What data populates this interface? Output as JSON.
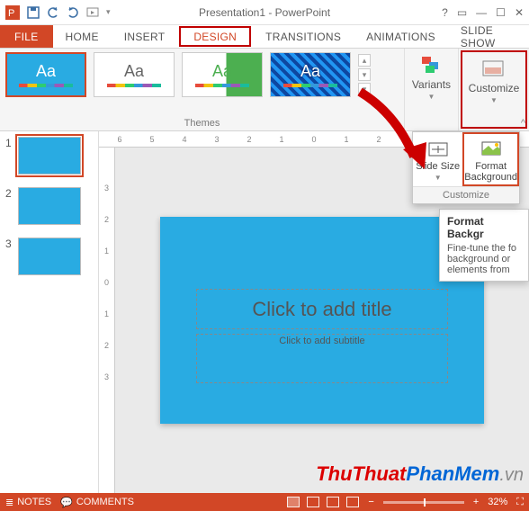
{
  "titlebar": {
    "title": "Presentation1 - PowerPoint"
  },
  "tabs": {
    "file": "FILE",
    "home": "HOME",
    "insert": "INSERT",
    "design": "DESIGN",
    "transitions": "TRANSITIONS",
    "animations": "ANIMATIONS",
    "slideshow": "SLIDE SHOW"
  },
  "ribbon": {
    "themes_label": "Themes",
    "variants_label": "Variants",
    "customize_label": "Customize",
    "theme_aa": "Aa"
  },
  "dropdown": {
    "slide_size": "Slide Size",
    "format_background": "Format Background",
    "footer": "Customize"
  },
  "tooltip": {
    "title": "Format Backgr",
    "body": "Fine-tune the fo background or elements from"
  },
  "ruler_h": [
    "6",
    "5",
    "4",
    "3",
    "2",
    "1",
    "0",
    "1",
    "2"
  ],
  "ruler_v": [
    "3",
    "2",
    "1",
    "0",
    "1",
    "2",
    "3"
  ],
  "thumbs": {
    "n1": "1",
    "n2": "2",
    "n3": "3"
  },
  "canvas": {
    "title_placeholder": "Click to add title",
    "subtitle_placeholder": "Click to add subtitle"
  },
  "status": {
    "notes": "NOTES",
    "comments": "COMMENTS",
    "zoom": "32%"
  },
  "watermark": {
    "a": "ThuThuat",
    "b": "PhanMem",
    "c": ".vn"
  }
}
